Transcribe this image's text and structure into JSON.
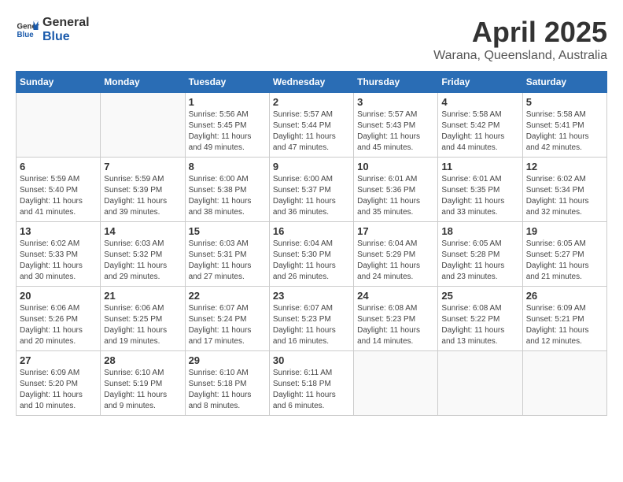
{
  "header": {
    "logo_general": "General",
    "logo_blue": "Blue",
    "title": "April 2025",
    "subtitle": "Warana, Queensland, Australia"
  },
  "weekdays": [
    "Sunday",
    "Monday",
    "Tuesday",
    "Wednesday",
    "Thursday",
    "Friday",
    "Saturday"
  ],
  "weeks": [
    [
      {
        "day": "",
        "detail": ""
      },
      {
        "day": "",
        "detail": ""
      },
      {
        "day": "1",
        "detail": "Sunrise: 5:56 AM\nSunset: 5:45 PM\nDaylight: 11 hours and 49 minutes."
      },
      {
        "day": "2",
        "detail": "Sunrise: 5:57 AM\nSunset: 5:44 PM\nDaylight: 11 hours and 47 minutes."
      },
      {
        "day": "3",
        "detail": "Sunrise: 5:57 AM\nSunset: 5:43 PM\nDaylight: 11 hours and 45 minutes."
      },
      {
        "day": "4",
        "detail": "Sunrise: 5:58 AM\nSunset: 5:42 PM\nDaylight: 11 hours and 44 minutes."
      },
      {
        "day": "5",
        "detail": "Sunrise: 5:58 AM\nSunset: 5:41 PM\nDaylight: 11 hours and 42 minutes."
      }
    ],
    [
      {
        "day": "6",
        "detail": "Sunrise: 5:59 AM\nSunset: 5:40 PM\nDaylight: 11 hours and 41 minutes."
      },
      {
        "day": "7",
        "detail": "Sunrise: 5:59 AM\nSunset: 5:39 PM\nDaylight: 11 hours and 39 minutes."
      },
      {
        "day": "8",
        "detail": "Sunrise: 6:00 AM\nSunset: 5:38 PM\nDaylight: 11 hours and 38 minutes."
      },
      {
        "day": "9",
        "detail": "Sunrise: 6:00 AM\nSunset: 5:37 PM\nDaylight: 11 hours and 36 minutes."
      },
      {
        "day": "10",
        "detail": "Sunrise: 6:01 AM\nSunset: 5:36 PM\nDaylight: 11 hours and 35 minutes."
      },
      {
        "day": "11",
        "detail": "Sunrise: 6:01 AM\nSunset: 5:35 PM\nDaylight: 11 hours and 33 minutes."
      },
      {
        "day": "12",
        "detail": "Sunrise: 6:02 AM\nSunset: 5:34 PM\nDaylight: 11 hours and 32 minutes."
      }
    ],
    [
      {
        "day": "13",
        "detail": "Sunrise: 6:02 AM\nSunset: 5:33 PM\nDaylight: 11 hours and 30 minutes."
      },
      {
        "day": "14",
        "detail": "Sunrise: 6:03 AM\nSunset: 5:32 PM\nDaylight: 11 hours and 29 minutes."
      },
      {
        "day": "15",
        "detail": "Sunrise: 6:03 AM\nSunset: 5:31 PM\nDaylight: 11 hours and 27 minutes."
      },
      {
        "day": "16",
        "detail": "Sunrise: 6:04 AM\nSunset: 5:30 PM\nDaylight: 11 hours and 26 minutes."
      },
      {
        "day": "17",
        "detail": "Sunrise: 6:04 AM\nSunset: 5:29 PM\nDaylight: 11 hours and 24 minutes."
      },
      {
        "day": "18",
        "detail": "Sunrise: 6:05 AM\nSunset: 5:28 PM\nDaylight: 11 hours and 23 minutes."
      },
      {
        "day": "19",
        "detail": "Sunrise: 6:05 AM\nSunset: 5:27 PM\nDaylight: 11 hours and 21 minutes."
      }
    ],
    [
      {
        "day": "20",
        "detail": "Sunrise: 6:06 AM\nSunset: 5:26 PM\nDaylight: 11 hours and 20 minutes."
      },
      {
        "day": "21",
        "detail": "Sunrise: 6:06 AM\nSunset: 5:25 PM\nDaylight: 11 hours and 19 minutes."
      },
      {
        "day": "22",
        "detail": "Sunrise: 6:07 AM\nSunset: 5:24 PM\nDaylight: 11 hours and 17 minutes."
      },
      {
        "day": "23",
        "detail": "Sunrise: 6:07 AM\nSunset: 5:23 PM\nDaylight: 11 hours and 16 minutes."
      },
      {
        "day": "24",
        "detail": "Sunrise: 6:08 AM\nSunset: 5:23 PM\nDaylight: 11 hours and 14 minutes."
      },
      {
        "day": "25",
        "detail": "Sunrise: 6:08 AM\nSunset: 5:22 PM\nDaylight: 11 hours and 13 minutes."
      },
      {
        "day": "26",
        "detail": "Sunrise: 6:09 AM\nSunset: 5:21 PM\nDaylight: 11 hours and 12 minutes."
      }
    ],
    [
      {
        "day": "27",
        "detail": "Sunrise: 6:09 AM\nSunset: 5:20 PM\nDaylight: 11 hours and 10 minutes."
      },
      {
        "day": "28",
        "detail": "Sunrise: 6:10 AM\nSunset: 5:19 PM\nDaylight: 11 hours and 9 minutes."
      },
      {
        "day": "29",
        "detail": "Sunrise: 6:10 AM\nSunset: 5:18 PM\nDaylight: 11 hours and 8 minutes."
      },
      {
        "day": "30",
        "detail": "Sunrise: 6:11 AM\nSunset: 5:18 PM\nDaylight: 11 hours and 6 minutes."
      },
      {
        "day": "",
        "detail": ""
      },
      {
        "day": "",
        "detail": ""
      },
      {
        "day": "",
        "detail": ""
      }
    ]
  ]
}
